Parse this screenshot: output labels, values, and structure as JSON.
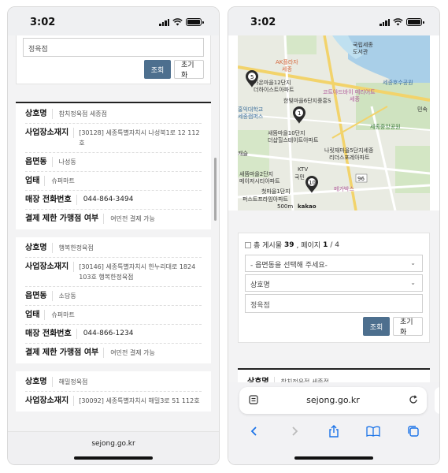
{
  "status": {
    "time": "3:02"
  },
  "left": {
    "search_input_value": "정육점",
    "search_label": "조회",
    "reset_label": "초기화",
    "footer_url": "sejong.go.kr",
    "cards": [
      {
        "fields": [
          {
            "label": "상호명",
            "value": "참치정육점 세종점"
          },
          {
            "label": "사업장소재지",
            "value": "[30128] 세종특별자치시 나성북1로 12 112호"
          },
          {
            "label": "읍면동",
            "value": "나성동"
          },
          {
            "label": "업태",
            "value": "슈퍼마트"
          },
          {
            "label": "매장 전화번호",
            "value": "044-864-3494"
          },
          {
            "label": "결제 제한 가맹점 여부",
            "value": "여민전 결제 가능"
          }
        ]
      },
      {
        "fields": [
          {
            "label": "상호명",
            "value": "행복한정육점"
          },
          {
            "label": "사업장소재지",
            "value": "[30146] 세종특별자치시 한누리대로 1824 103호 행복한정육점"
          },
          {
            "label": "읍면동",
            "value": "소담동"
          },
          {
            "label": "업태",
            "value": "슈퍼마트"
          },
          {
            "label": "매장 전화번호",
            "value": "044-866-1234"
          },
          {
            "label": "결제 제한 가맹점 여부",
            "value": "여민전 결제 가능"
          }
        ]
      },
      {
        "fields": [
          {
            "label": "상호명",
            "value": "해밀정육점"
          },
          {
            "label": "사업장소재지",
            "value": "[30092] 세종특별자치시 해밀3로 51 112호"
          }
        ]
      }
    ]
  },
  "right": {
    "count_prefix": "총 게시물",
    "count_total": "39",
    "count_page_label": ", 페이지",
    "count_page": "1",
    "count_pages": "/ 4",
    "dong_select": "- 읍면동을 선택해 주세요-",
    "field_select": "상호명",
    "search_input_value": "정육점",
    "search_label": "조회",
    "reset_label": "초기화",
    "first_result_label": "상호명",
    "first_result_value": "참치정육점 세종점",
    "url": "sejong.go.kr",
    "map": {
      "labels": {
        "library": "국립세종\n도서관",
        "lake": "세종호수공원",
        "ak": "AK플라자\n세종",
        "apt1": "가온마을12단지\n더하이스트아파트",
        "hanbit": "한빛마을6단지중흥S",
        "kotra": "코트야드바이 메리어트\n세종",
        "univ": "홍익대학교\n세종캠퍼스",
        "apt2": "새뜸마을10단지\n더샵힐스테이트아파트",
        "park": "세종중앙공원",
        "naru": "나릿재마을5단지세종\n리더스포레아파트",
        "castle": "캐슬",
        "apt3": "새뜸마을2단지\n메이저시티아파트",
        "cheot": "첫마을1단지\n퍼스트프라임아파트",
        "ktv": "KTV",
        "mega": "메가박스",
        "kookmin": "국민",
        "minsok": "민속",
        "road": "96",
        "scale": "500m",
        "kakao": "kakao"
      },
      "markers": [
        "5",
        "1",
        "10"
      ]
    }
  }
}
